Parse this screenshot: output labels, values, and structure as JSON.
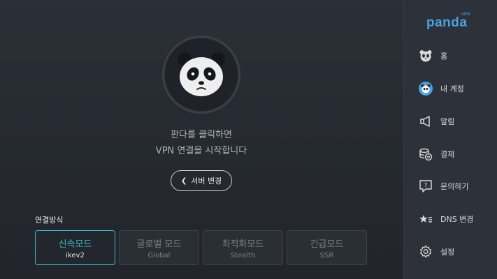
{
  "colors": {
    "accent": "#3ab8c7",
    "brand": "#4aa3df",
    "sidebar_bg": "#2d3139",
    "main_bg": "#252930"
  },
  "brand": {
    "logo": "panda",
    "logo_sup": "VPN"
  },
  "connect": {
    "hint_line1": "판다를 클릭하면",
    "hint_line2": "VPN 연결을 시작합니다",
    "server_button": "서버 변경"
  },
  "connection": {
    "section_label": "연결방식",
    "modes": [
      {
        "title": "신속모드",
        "sub": "ikev2",
        "active": true
      },
      {
        "title": "글로벌 모드",
        "sub": "Global",
        "active": false
      },
      {
        "title": "최적화모드",
        "sub": "Stealth",
        "active": false
      },
      {
        "title": "긴급모드",
        "sub": "SSR",
        "active": false
      }
    ]
  },
  "sidebar": {
    "items": [
      {
        "label": "홈",
        "icon": "panda-home-icon"
      },
      {
        "label": "내 계정",
        "icon": "account-icon"
      },
      {
        "label": "알림",
        "icon": "megaphone-icon"
      },
      {
        "label": "결제",
        "icon": "payment-icon"
      },
      {
        "label": "문의하기",
        "icon": "question-icon"
      },
      {
        "label": "DNS 변경",
        "icon": "dns-star-icon"
      },
      {
        "label": "설정",
        "icon": "gear-icon"
      }
    ]
  }
}
